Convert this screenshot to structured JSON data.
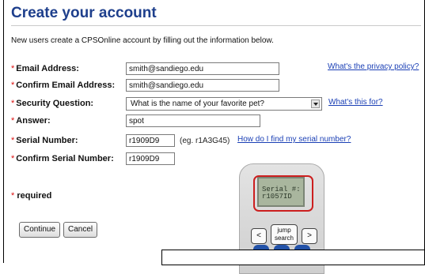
{
  "title": "Create your account",
  "intro": "New users create a CPSOnline account by filling out the information below.",
  "star": "*",
  "fields": {
    "email": {
      "label": "Email Address:",
      "value": "smith@sandiego.edu"
    },
    "confirm_email": {
      "label": "Confirm Email Address:",
      "value": "smith@sandiego.edu"
    },
    "security_question": {
      "label": "Security Question:",
      "value": "What is the name of your favorite pet?"
    },
    "answer": {
      "label": "Answer:",
      "value": "spot"
    },
    "serial": {
      "label": "Serial Number:",
      "value": "r1909D9",
      "example": "(eg. r1A3G45)"
    },
    "confirm_serial": {
      "label": "Confirm Serial Number:",
      "value": "r1909D9"
    }
  },
  "links": {
    "privacy": "What's the privacy policy?",
    "what_for": "What's this for?",
    "find_serial": "How do I find my serial number?"
  },
  "required_text": "required",
  "buttons": {
    "continue": "Continue",
    "cancel": "Cancel"
  },
  "device": {
    "screen_line1": "Serial #:",
    "screen_line2": "r1057ID",
    "key_left": "<",
    "key_jump_line1": "jump",
    "key_jump_line2": "search",
    "key_right": ">"
  },
  "colors": {
    "title": "#1e3f8c",
    "link": "#1a3fb5",
    "required_star": "#d11111",
    "highlight": "#cc1f1f"
  }
}
